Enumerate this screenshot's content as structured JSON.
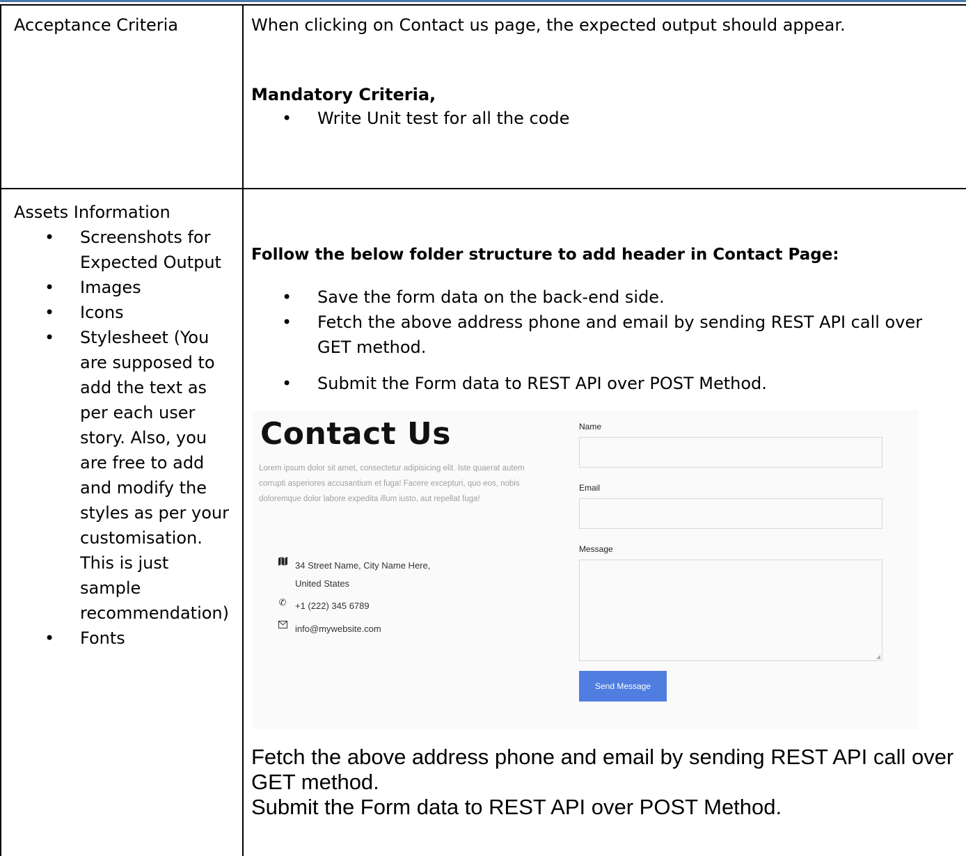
{
  "acceptance": {
    "heading": "Acceptance Criteria",
    "intro": "When clicking on Contact us page, the expected output should appear.",
    "mandatory_label": "Mandatory Criteria,",
    "mandatory_items": [
      "Write Unit test for all the code"
    ]
  },
  "assets": {
    "heading": "Assets Information",
    "items": [
      "Screenshots for Expected Output",
      "Images",
      "Icons",
      "Stylesheet (You are supposed to add the text as per each user story. Also, you are free to add and modify the styles as per your customisation. This is just sample recommendation)",
      "Fonts"
    ],
    "instruction": "Follow the below folder structure to add header in Contact Page:",
    "steps": [
      "Save the form data on the back-end side.",
      "Fetch the above address phone and email by sending REST API call over GET method.",
      "Submit the Form data to REST API over POST Method."
    ]
  },
  "contact_mockup": {
    "title": "Contact Us",
    "lorem": "Lorem ipsum dolor sit amet, consectetur adipisicing elit. Iste quaerat autem corrupti asperiores accusantium et fuga! Facere excepturi, quo eos, nobis doloremque dolor labore expedita illum iusto, aut repellat fuga!",
    "address_line1": "34 Street Name, City Name Here,",
    "address_line2": "United States",
    "phone": "+1 (222) 345 6789",
    "email": "info@mywebsite.com",
    "icons": [
      "map-icon",
      "phone-icon",
      "mail-icon"
    ],
    "name_label": "Name",
    "email_label": "Email",
    "message_label": "Message",
    "send_button": "Send Message",
    "button_color": "#4f7de0"
  },
  "footer_text": {
    "line1": "Fetch the above address phone and email by sending REST API call over",
    "line2": "GET method.",
    "line3": "Submit the Form data to REST API over POST Method."
  }
}
